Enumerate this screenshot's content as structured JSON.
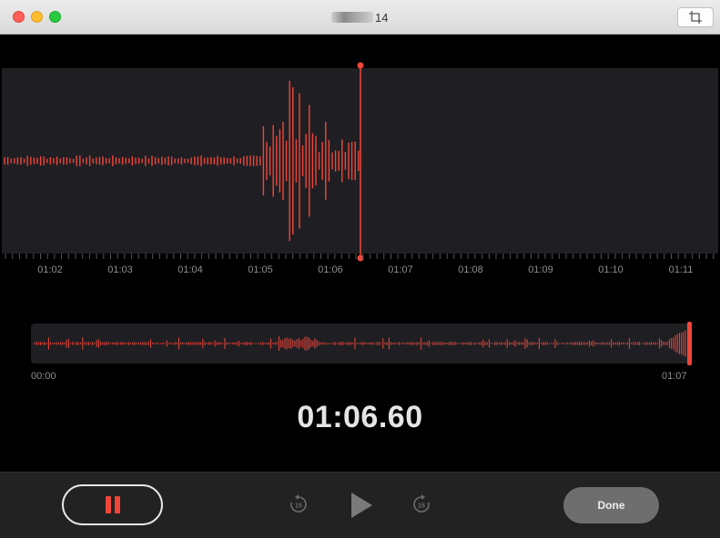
{
  "window": {
    "title_suffix": "14"
  },
  "colors": {
    "accent": "#f0463a",
    "waveform_bg": "#1f1f23",
    "background": "#000000",
    "done_button": "#6e6e6e"
  },
  "timeline": {
    "ticks": [
      "01:02",
      "01:03",
      "01:04",
      "01:05",
      "01:06",
      "01:07",
      "01:08",
      "01:09",
      "01:10",
      "01:11"
    ]
  },
  "overview": {
    "start_label": "00:00",
    "end_label": "01:07"
  },
  "timer": "01:06.60",
  "controls": {
    "pause_icon": "pause-icon",
    "skip_back_icon": "skip-back-15-icon",
    "play_icon": "play-icon",
    "skip_forward_icon": "skip-forward-15-icon",
    "skip_back_text": "15",
    "skip_forward_text": "15",
    "done_label": "Done"
  }
}
